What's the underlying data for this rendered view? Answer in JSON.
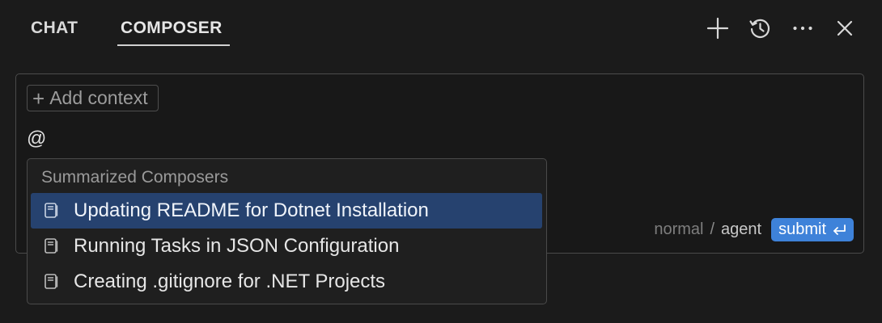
{
  "header": {
    "tabs": [
      {
        "label": "CHAT",
        "active": false
      },
      {
        "label": "COMPOSER",
        "active": true
      }
    ],
    "actions": [
      {
        "icon": "plus-icon",
        "label": "new composer"
      },
      {
        "icon": "history-icon",
        "label": "history"
      },
      {
        "icon": "more-icon",
        "label": "more"
      },
      {
        "icon": "close-icon",
        "label": "close"
      }
    ]
  },
  "composer": {
    "add_context_label": "Add context",
    "input_value": "@",
    "mode_normal": "normal",
    "mode_separator": "/",
    "mode_agent": "agent",
    "submit_label": "submit",
    "submit_icon": "enter-icon"
  },
  "mention_menu": {
    "section_title": "Summarized Composers",
    "items": [
      {
        "label": "Updating README for Dotnet Installation",
        "icon": "document-icon",
        "selected": true
      },
      {
        "label": "Running Tasks in JSON Configuration",
        "icon": "document-icon",
        "selected": false
      },
      {
        "label": "Creating .gitignore for .NET Projects",
        "icon": "document-icon",
        "selected": false
      }
    ]
  },
  "colors": {
    "background": "#1b1b1b",
    "accent": "#3e82d9",
    "selected_row": "#26426f",
    "border": "#4b4b4b"
  }
}
